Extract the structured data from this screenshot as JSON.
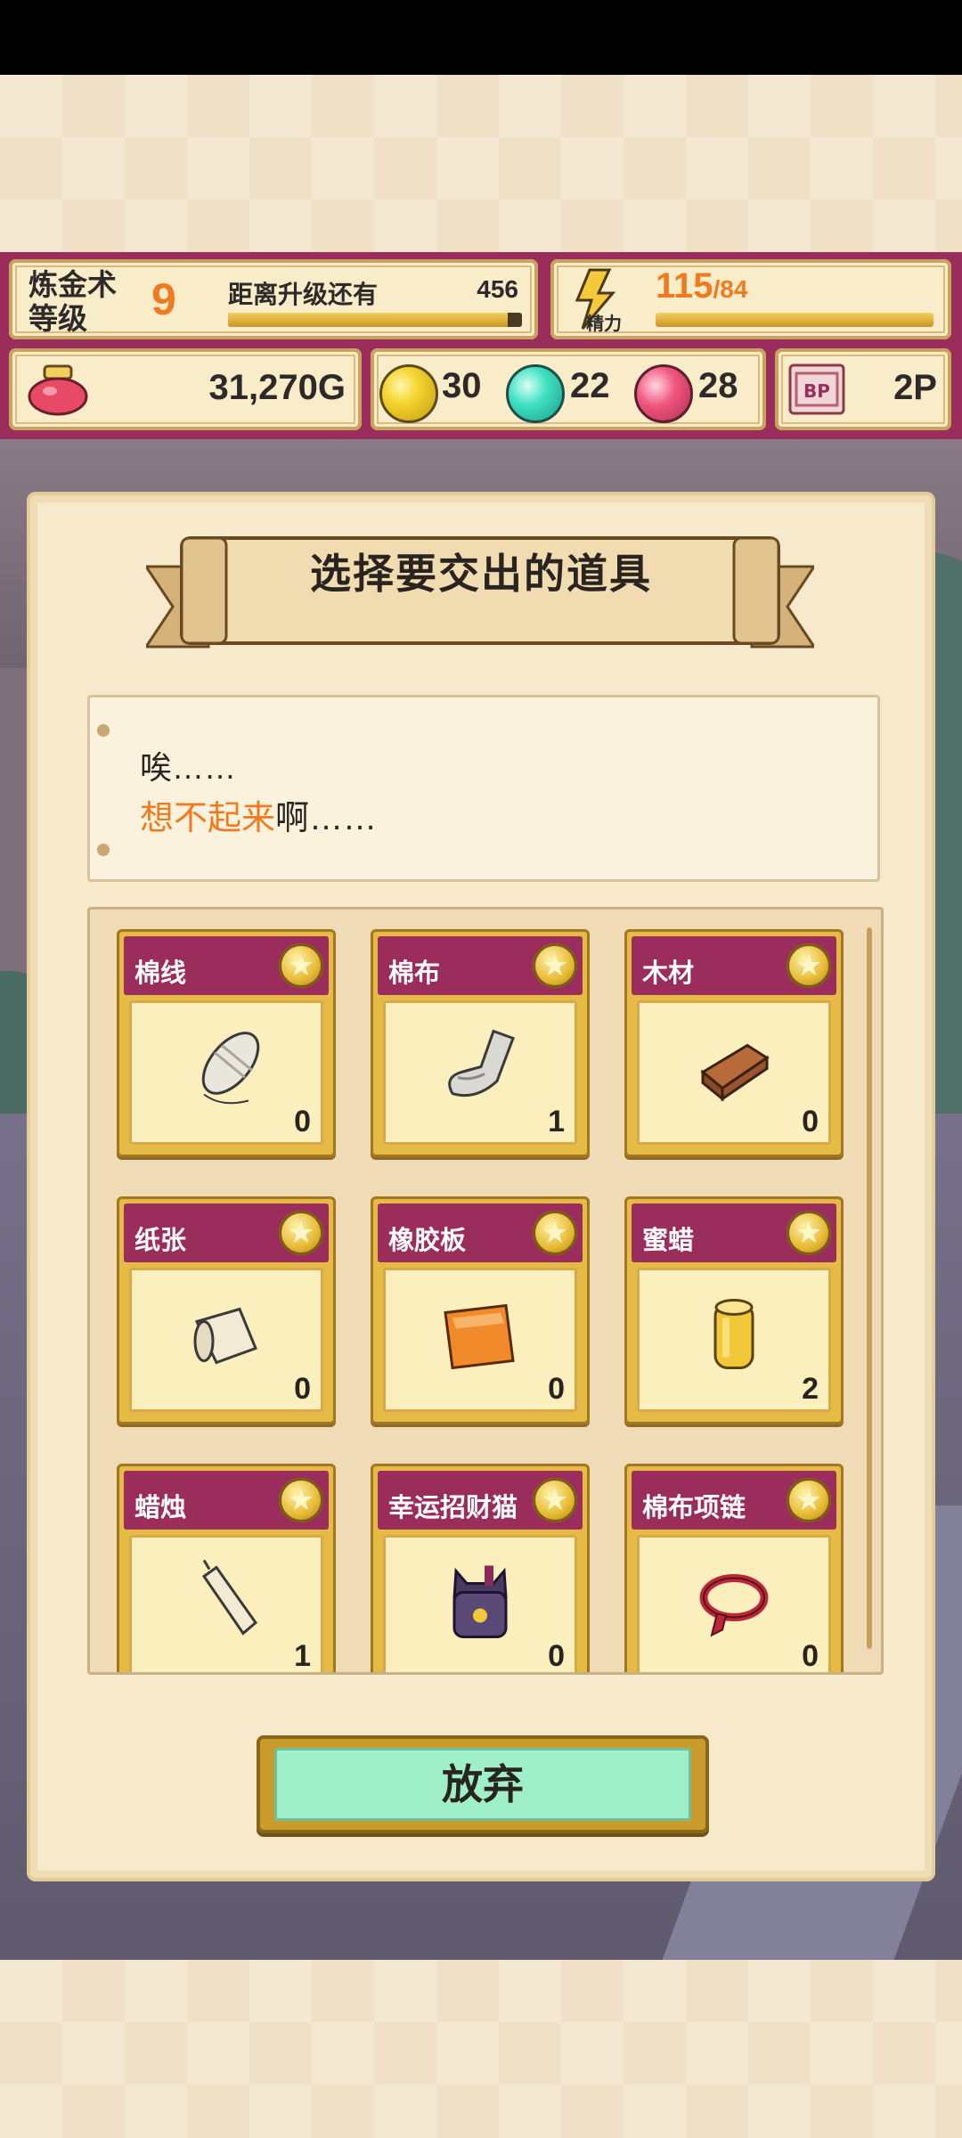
{
  "hud": {
    "level_label": "炼金术等级",
    "level": "9",
    "next_level_text": "距离升级还有",
    "next_level_value": "456",
    "level_progress": 0.95,
    "energy_label": "精力",
    "energy_value": "115",
    "energy_max": "/84",
    "energy_progress": 1.0,
    "gold": "31,270G",
    "gem_yellow": "30",
    "gem_cyan": "22",
    "gem_pink": "28",
    "bp": "2P"
  },
  "dialog": {
    "title": "选择要交出的道具",
    "note_line1": "唉……",
    "note_highlight": "想不起来",
    "note_line2_rest": "啊……",
    "items": [
      {
        "name": "棉线",
        "count": "0",
        "icon": "cotton-thread-icon"
      },
      {
        "name": "棉布",
        "count": "1",
        "icon": "cotton-cloth-icon"
      },
      {
        "name": "木材",
        "count": "0",
        "icon": "wood-icon"
      },
      {
        "name": "纸张",
        "count": "0",
        "icon": "paper-icon"
      },
      {
        "name": "橡胶板",
        "count": "0",
        "icon": "rubber-sheet-icon"
      },
      {
        "name": "蜜蜡",
        "count": "2",
        "icon": "beeswax-icon"
      },
      {
        "name": "蜡烛",
        "count": "1",
        "icon": "candle-icon"
      },
      {
        "name": "幸运招财猫",
        "count": "0",
        "icon": "lucky-cat-icon"
      },
      {
        "name": "棉布项链",
        "count": "0",
        "icon": "cloth-necklace-icon"
      }
    ],
    "give_up_label": "放弃"
  },
  "colors": {
    "accent_orange": "#ef7a20",
    "hud_magenta": "#9b2d5c",
    "button_mint": "#9ff0c9"
  }
}
